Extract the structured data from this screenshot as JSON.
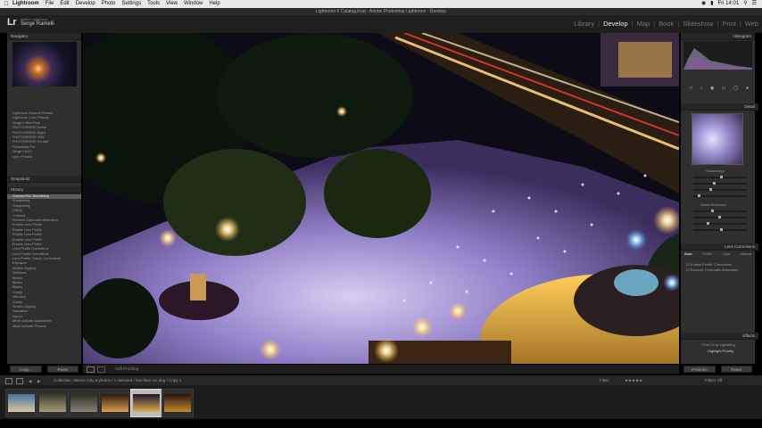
{
  "menubar": {
    "app": "Lightroom",
    "items": [
      "File",
      "Edit",
      "Develop",
      "Photo",
      "Settings",
      "Tools",
      "View",
      "Window",
      "Help"
    ],
    "clock": "Fri 14:01"
  },
  "window": {
    "title": "Lightroom 6 Catalog.lrcat - Adobe Photoshop Lightroom - Develop"
  },
  "identity": {
    "logo": "Lr",
    "line1": "Adobe Lightroom",
    "line2": "Serge Ramelli"
  },
  "modules": [
    "Library",
    "Develop",
    "Map",
    "Book",
    "Slideshow",
    "Print",
    "Web"
  ],
  "active_module": "Develop",
  "left_panel": {
    "navigator_label": "Navigator",
    "presets_items": [
      "Lightroom General Presets",
      "Lightroom Color Presets",
      "Serge's Ultra Pack",
      "PHOTOSERGE Urban",
      "PHOTOSERGE Night",
      "PHOTOSERGE HDR",
      "PHOTOSERGE Portrait",
      "Photoshop Pro",
      "Serge's NYC",
      "User Presets"
    ],
    "snapshots_label": "Snapshots",
    "history_label": "History",
    "history_items": [
      "Camera Pro: Something",
      "Sharpening",
      "Sharpening",
      "Clarity",
      "Contrast",
      "Remove Chromatic Aberration",
      "Enable Lens Profile",
      "Enable Lens Profile",
      "Enable Lens Profile",
      "Enable Lens Profile",
      "Enable Lens Profile",
      "Lens Profile Corrections",
      "Lens Profile Corrections",
      "Lens Profile: Canon Corrections",
      "Exposure",
      "Whites Clipping",
      "Shadows",
      "Blacks",
      "Blacks",
      "Blacks",
      "Clarity",
      "Vibrance",
      "Clarity",
      "Whites Clipping",
      "Saturation",
      "Import",
      "Mesh Activate Adjustment",
      "Mesh Activate Presets"
    ],
    "copy_label": "Copy...",
    "paste_label": "Paste"
  },
  "toolbar": {
    "soft_proofing_label": "Soft Proofing"
  },
  "right_panel": {
    "histogram_label": "Histogram",
    "detail_label": "Detail",
    "sharpening_label": "Sharpening",
    "noise_label": "Noise Reduction",
    "lens_label": "Lens Corrections",
    "lens_tabs": [
      "Basic",
      "Profile",
      "Color",
      "Manual"
    ],
    "lens_options": [
      "Enable Profile Corrections",
      "Remove Chromatic Aberration"
    ],
    "effects_label": "Effects",
    "effects_sub": "Post-Crop Vignetting",
    "effects_style": "Highlight Priority",
    "previous_label": "Previous",
    "reset_label": "Reset"
  },
  "filmstrip": {
    "info": "Collection: Mexico City   6 photos / 1 selected / last-fave-mx.dng / Copy 1",
    "filter_label": "Filter:",
    "filter_value": "Filters Off",
    "thumbs": [
      {
        "colors": [
          "#4a6fa1",
          "#d9c9a0"
        ]
      },
      {
        "colors": [
          "#3a3a2a",
          "#a69b7a"
        ]
      },
      {
        "colors": [
          "#2e2a24",
          "#8b8374"
        ]
      },
      {
        "colors": [
          "#2a1a10",
          "#d9a04a"
        ]
      },
      {
        "colors": [
          "#1a1530",
          "#e0b050"
        ]
      },
      {
        "colors": [
          "#201510",
          "#c88a30"
        ]
      }
    ],
    "selected_index": 4
  }
}
